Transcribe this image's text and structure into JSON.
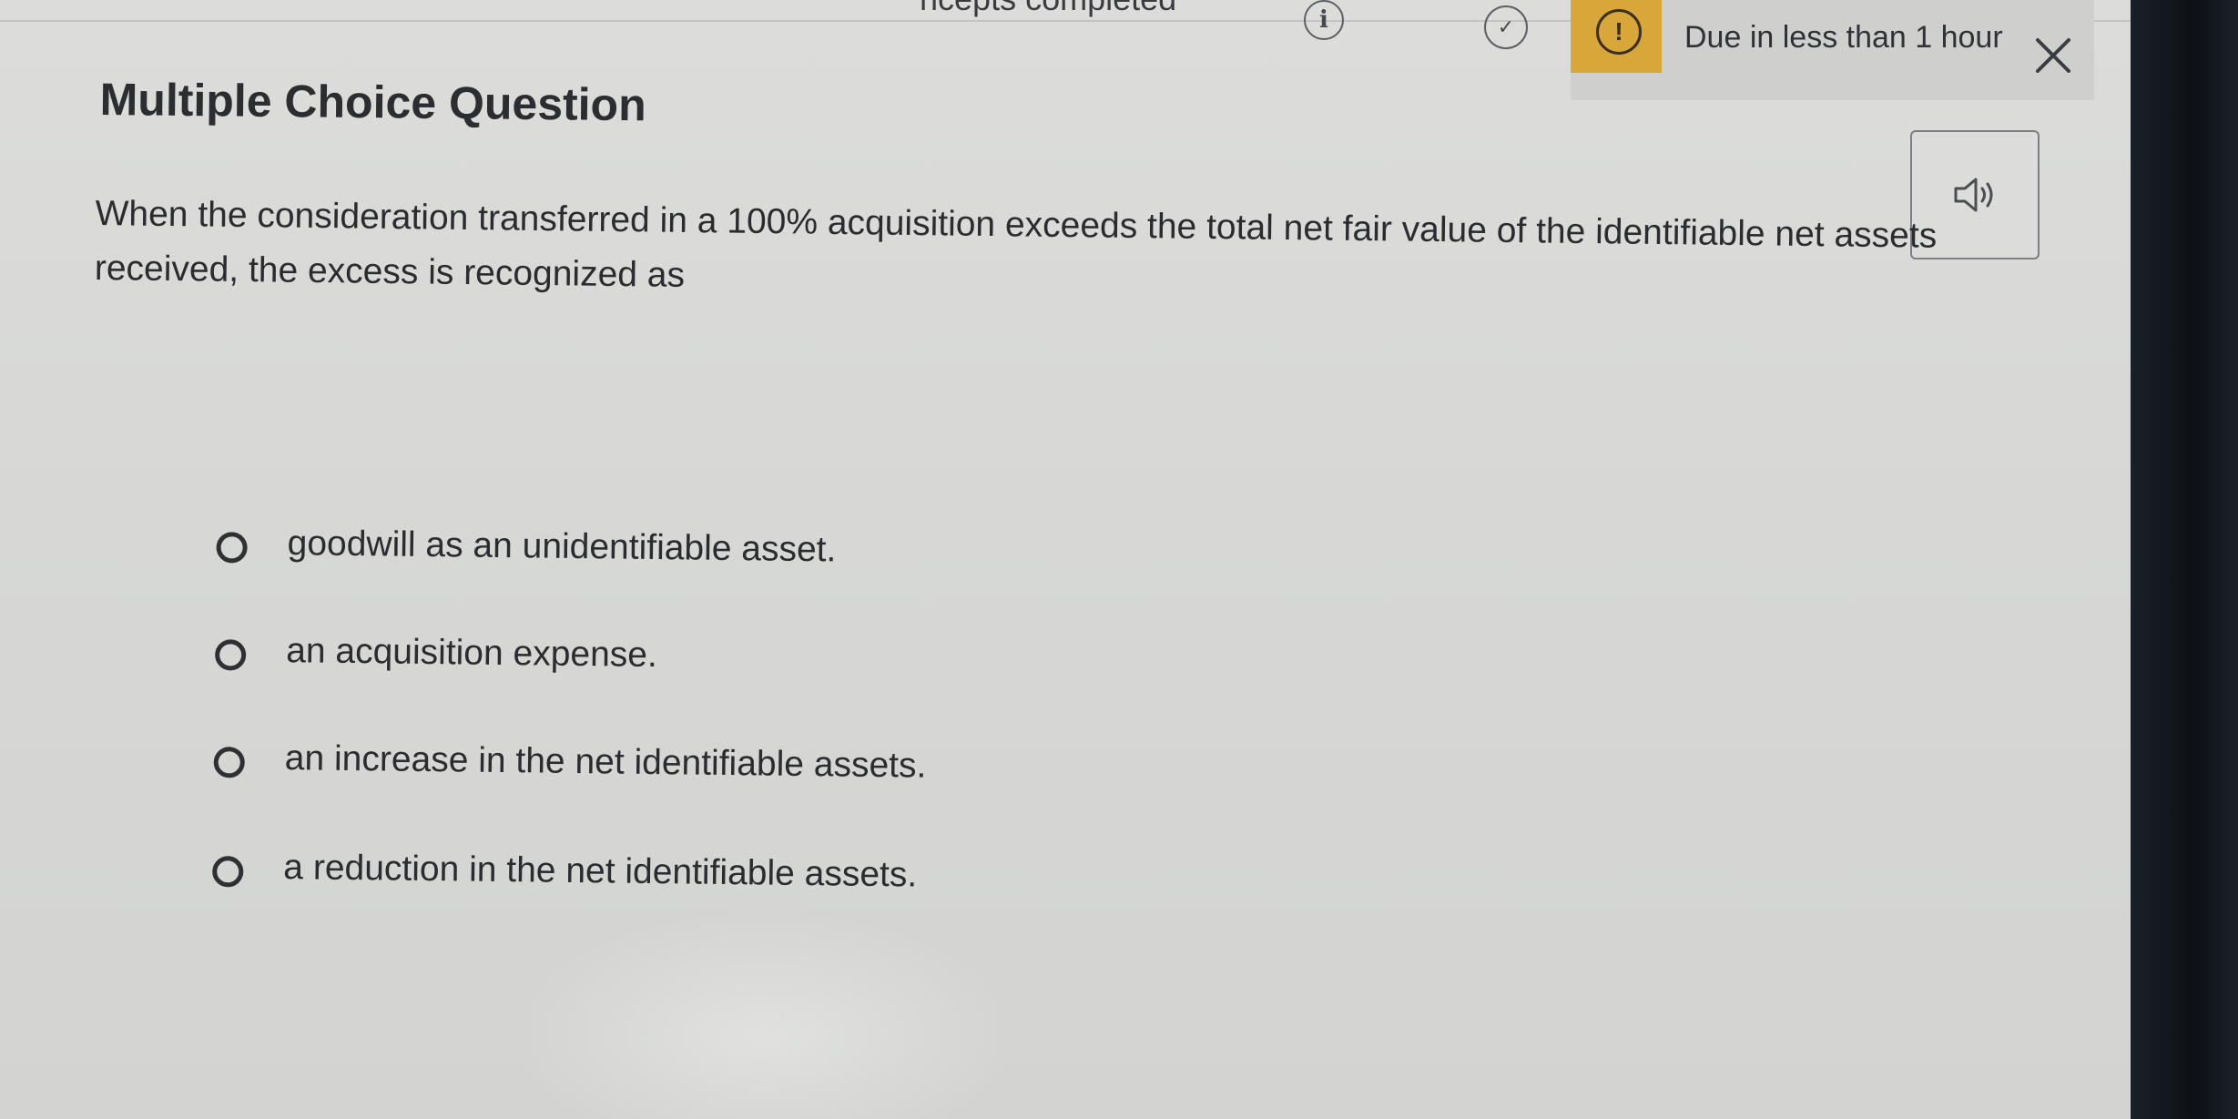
{
  "topbar": {
    "concepts_text": "ncepts completed",
    "due_text": "Due in less than 1 hour"
  },
  "question": {
    "type_title": "Multiple Choice Question",
    "prompt": "When the consideration transferred in a 100% acquisition exceeds the total net fair value of the identifiable net assets received, the excess is recognized as",
    "options": [
      {
        "label": "goodwill as an unidentifiable asset."
      },
      {
        "label": "an acquisition expense."
      },
      {
        "label": "an increase in the net identifiable assets."
      },
      {
        "label": "a reduction in the net identifiable assets."
      }
    ]
  },
  "icons": {
    "info": "info-icon",
    "check": "check-circle-icon",
    "alert": "exclamation-icon",
    "close": "close-icon",
    "audio": "speaker-icon"
  },
  "colors": {
    "alert_accent": "#d9a63a",
    "text_primary": "#2a2c2f",
    "background": "#d8d9d7"
  }
}
